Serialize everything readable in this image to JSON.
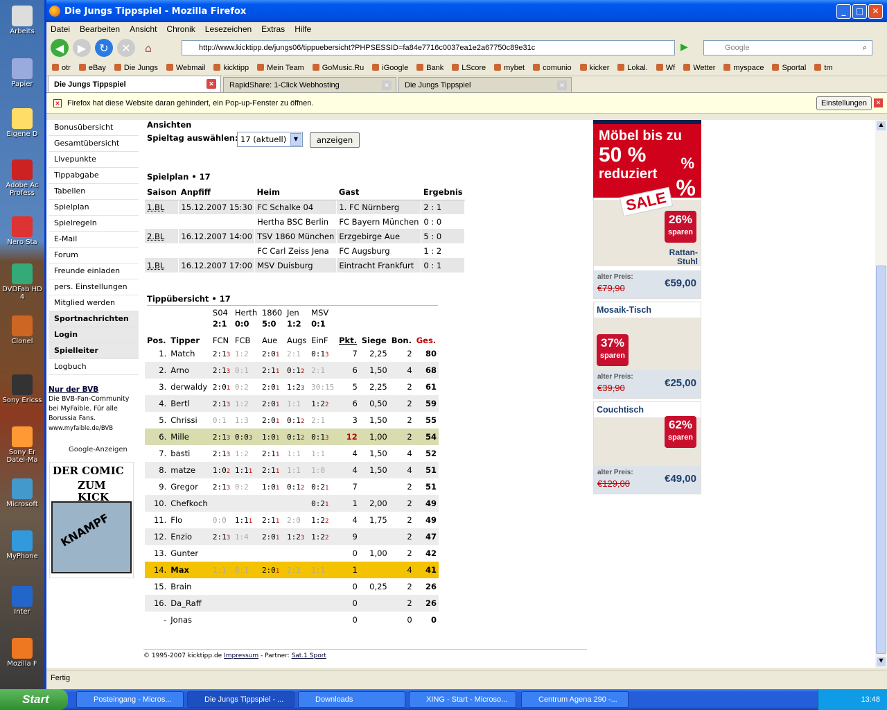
{
  "window": {
    "title": "Die Jungs Tippspiel - Mozilla Firefox"
  },
  "menu": [
    "Datei",
    "Bearbeiten",
    "Ansicht",
    "Chronik",
    "Lesezeichen",
    "Extras",
    "Hilfe"
  ],
  "url": "http://www.kicktipp.de/jungs06/tippuebersicht?PHPSESSID=fa84e7716c0037ea1e2a67750c89e31c",
  "search_placeholder": "Google",
  "bookmarks": [
    "otr",
    "eBay",
    "Die Jungs",
    "Webmail",
    "kicktipp",
    "Mein Team",
    "GoMusic.Ru",
    "iGoogle",
    "Bank",
    "LScore",
    "mybet",
    "comunio",
    "kicker",
    "Lokal.",
    "Wf",
    "Wetter",
    "myspace",
    "Sportal",
    "tm"
  ],
  "tabs": [
    "Die Jungs Tippspiel",
    "RapidShare: 1-Click Webhosting",
    "Die Jungs Tippspiel"
  ],
  "infobar": {
    "text": "Firefox hat diese Website daran gehindert, ein Pop-up-Fenster zu öffnen.",
    "button": "Einstellungen"
  },
  "status": "Fertig",
  "desktop": [
    "Arbeits",
    "Papier",
    "Eigene D",
    "Adobe Ac Profess",
    "Nero Sta",
    "DVDFab HD 4",
    "Clonel",
    "Sony Ericss",
    "Sony Er Datei-Ma",
    "Microsoft",
    "MyPhone",
    "Inter",
    "Mozilla F"
  ],
  "nav": [
    "Bonusübersicht",
    "Gesamtübersicht",
    "Livepunkte",
    "Tippabgabe",
    "Tabellen",
    "Spielplan",
    "Spielregeln",
    "E-Mail",
    "Forum",
    "Freunde einladen",
    "pers. Einstellungen",
    "Mitglied werden",
    "Sportnachrichten",
    "Login",
    "Spielleiter",
    "Logbuch"
  ],
  "bvb": {
    "title": "Nur der BVB",
    "l1": "Die BVB-Fan-Community",
    "l2": "bei MyFaible. Für alle",
    "l3": "Borussia Fans.",
    "l4": "www.myfaible.de/BVB"
  },
  "gads": "Google-Anzeigen",
  "comic": {
    "l1": "DER COMIC",
    "l2": "ZUM KICK",
    "pic": "KNAMPF"
  },
  "ansichten": "Ansichten",
  "spieltag_label": "Spieltag auswählen:",
  "spieltag_value": "17 (aktuell)",
  "anzeigen": "anzeigen",
  "spielplan_title": "Spielplan • 17",
  "plan_headers": [
    "Saison",
    "Anpfiff",
    "Heim",
    "Gast",
    "Ergebnis"
  ],
  "plan": [
    [
      "1.BL",
      "15.12.2007 15:30",
      "FC Schalke 04",
      "1. FC Nürnberg",
      "2 : 1"
    ],
    [
      "",
      "",
      "Hertha BSC Berlin",
      "FC Bayern München",
      "0 : 0"
    ],
    [
      "2.BL",
      "16.12.2007 14:00",
      "TSV 1860 München",
      "Erzgebirge Aue",
      "5 : 0"
    ],
    [
      "",
      "",
      "FC Carl Zeiss Jena",
      "FC Augsburg",
      "1 : 2"
    ],
    [
      "1.BL",
      "16.12.2007 17:00",
      "MSV Duisburg",
      "Eintracht Frankfurt",
      "0 : 1"
    ]
  ],
  "tipp_title": "Tippübersicht • 17",
  "tipp_games": [
    {
      "a": "S04",
      "r": "2:1",
      "b": "FCN"
    },
    {
      "a": "Herth",
      "r": "0:0",
      "b": "FCB"
    },
    {
      "a": "1860",
      "r": "5:0",
      "b": "Aue"
    },
    {
      "a": "Jen",
      "r": "1:2",
      "b": "Augs"
    },
    {
      "a": "MSV",
      "r": "0:1",
      "b": "EinF"
    }
  ],
  "tipp_headers": {
    "pos": "Pos.",
    "tipper": "Tipper",
    "pkt": "Pkt.",
    "siege": "Siege",
    "bon": "Bon.",
    "ges": "Ges."
  },
  "tipp": [
    [
      "1.",
      "Match",
      [
        "2:1",
        "3"
      ],
      [
        "1:2",
        ""
      ],
      [
        "2:0",
        "1"
      ],
      [
        "2:1",
        ""
      ],
      [
        "0:1",
        "3"
      ],
      "7",
      "2,25",
      "2",
      "80"
    ],
    [
      "2.",
      "Arno",
      [
        "2:1",
        "3"
      ],
      [
        "0:1",
        ""
      ],
      [
        "2:1",
        "1"
      ],
      [
        "0:1",
        "2"
      ],
      [
        "2:1",
        ""
      ],
      "6",
      "1,50",
      "4",
      "68"
    ],
    [
      "3.",
      "derwaldy",
      [
        "2:0",
        "1"
      ],
      [
        "0:2",
        ""
      ],
      [
        "2:0",
        "1"
      ],
      [
        "1:2",
        "3"
      ],
      [
        "30:15",
        ""
      ],
      "5",
      "2,25",
      "2",
      "61"
    ],
    [
      "4.",
      "Bertl",
      [
        "2:1",
        "3"
      ],
      [
        "1:2",
        ""
      ],
      [
        "2:0",
        "1"
      ],
      [
        "1:1",
        ""
      ],
      [
        "1:2",
        "2"
      ],
      "6",
      "0,50",
      "2",
      "59"
    ],
    [
      "5.",
      "Chrissi",
      [
        "0:1",
        ""
      ],
      [
        "1:3",
        ""
      ],
      [
        "2:0",
        "1"
      ],
      [
        "0:1",
        "2"
      ],
      [
        "2:1",
        ""
      ],
      "3",
      "1,50",
      "2",
      "55"
    ],
    [
      "6.",
      "Mille",
      [
        "2:1",
        "3"
      ],
      [
        "0:0",
        "3"
      ],
      [
        "1:0",
        "1"
      ],
      [
        "0:1",
        "2"
      ],
      [
        "0:1",
        "3"
      ],
      "12",
      "1,00",
      "2",
      "54"
    ],
    [
      "7.",
      "basti",
      [
        "2:1",
        "3"
      ],
      [
        "1:2",
        ""
      ],
      [
        "2:1",
        "1"
      ],
      [
        "1:1",
        ""
      ],
      [
        "1:1",
        ""
      ],
      "4",
      "1,50",
      "4",
      "52"
    ],
    [
      "8.",
      "matze",
      [
        "1:0",
        "2"
      ],
      [
        "1:1",
        "1"
      ],
      [
        "2:1",
        "1"
      ],
      [
        "1:1",
        ""
      ],
      [
        "1:0",
        ""
      ],
      "4",
      "1,50",
      "4",
      "51"
    ],
    [
      "9.",
      "Gregor",
      [
        "2:1",
        "3"
      ],
      [
        "0:2",
        ""
      ],
      [
        "1:0",
        "1"
      ],
      [
        "0:1",
        "2"
      ],
      [
        "0:2",
        "1"
      ],
      "7",
      "",
      "2",
      "51"
    ],
    [
      "10.",
      "Chefkoch",
      [
        "",
        ""
      ],
      [
        "",
        ""
      ],
      [
        "",
        ""
      ],
      [
        "",
        ""
      ],
      [
        "0:2",
        "1"
      ],
      "1",
      "2,00",
      "2",
      "49"
    ],
    [
      "11.",
      "Flo",
      [
        "0:0",
        ""
      ],
      [
        "1:1",
        "1"
      ],
      [
        "2:1",
        "1"
      ],
      [
        "2:0",
        ""
      ],
      [
        "1:2",
        "2"
      ],
      "4",
      "1,75",
      "2",
      "49"
    ],
    [
      "12.",
      "Enzio",
      [
        "2:1",
        "3"
      ],
      [
        "1:4",
        ""
      ],
      [
        "2:0",
        "1"
      ],
      [
        "1:2",
        "3"
      ],
      [
        "1:2",
        "2"
      ],
      "9",
      "",
      "2",
      "47"
    ],
    [
      "13.",
      "Gunter",
      [
        "",
        ""
      ],
      [
        "",
        ""
      ],
      [
        "",
        ""
      ],
      [
        "",
        ""
      ],
      [
        "",
        ""
      ],
      "0",
      "1,00",
      "2",
      "42"
    ],
    [
      "14.",
      "Max",
      [
        "1:1",
        ""
      ],
      [
        "0:1",
        ""
      ],
      [
        "2:0",
        "1"
      ],
      [
        "2:1",
        ""
      ],
      [
        "1:1",
        ""
      ],
      "1",
      "",
      "4",
      "41"
    ],
    [
      "15.",
      "Brain",
      [
        "",
        ""
      ],
      [
        "",
        ""
      ],
      [
        "",
        ""
      ],
      [
        "",
        ""
      ],
      [
        "",
        ""
      ],
      "0",
      "0,25",
      "2",
      "26"
    ],
    [
      "16.",
      "Da_Raff",
      [
        "",
        ""
      ],
      [
        "",
        ""
      ],
      [
        "",
        ""
      ],
      [
        "",
        ""
      ],
      [
        "",
        ""
      ],
      "0",
      "",
      "2",
      "26"
    ],
    [
      "-",
      "Jonas",
      [
        "",
        ""
      ],
      [
        "",
        ""
      ],
      [
        "",
        ""
      ],
      [
        "",
        ""
      ],
      [
        "",
        ""
      ],
      "0",
      "",
      "0",
      "0"
    ]
  ],
  "topad": {
    "l1": "Möbel bis zu",
    "l2": "50 %",
    "l3": "reduziert",
    "sale": "SALE",
    "pct": "%"
  },
  "ads": [
    {
      "name": "",
      "pct": "26%",
      "sparen": "sparen",
      "item": "Rattan-Stuhl",
      "alt": "alter Preis:",
      "old": "€79,90",
      "new": "€59,00"
    },
    {
      "name": "Mosaik-Tisch",
      "pct": "37%",
      "sparen": "sparen",
      "item": "",
      "alt": "alter Preis:",
      "old": "€39,90",
      "new": "€25,00"
    },
    {
      "name": "Couchtisch",
      "pct": "62%",
      "sparen": "sparen",
      "item": "",
      "alt": "alter Preis:",
      "old": "€129,00",
      "new": "€49,00"
    }
  ],
  "footer": {
    "copy": "© 1995-2007 kicktipp.de",
    "impressum": "Impressum",
    "sep1": " - Partner: ",
    "partner": "Sat.1 Sport"
  },
  "taskbar": {
    "start": "Start",
    "items": [
      "Posteingang - Micros...",
      "Die Jungs Tippspiel - ...",
      "Downloads",
      "XING - Start - Microso...",
      "Centrum Agena 290 -..."
    ],
    "clock": "13:48"
  }
}
